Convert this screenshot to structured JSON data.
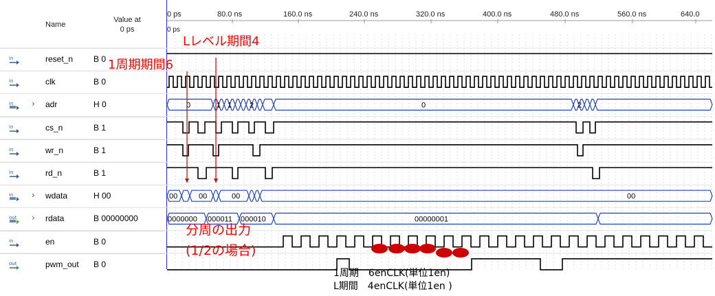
{
  "header": {
    "name_col": "Name",
    "value_col_line1": "Value at",
    "value_col_line2": "0 ps",
    "cursor_label": "0 ps",
    "time_ticks": [
      "0 ps",
      "80.0 ns",
      "160.0 ns",
      "240.0 ns",
      "320.0 ns",
      "400.0 ns",
      "480.0 ns",
      "560.0 ns",
      "640.0"
    ]
  },
  "signals": [
    {
      "name": "reset_n",
      "value": "B 0",
      "dir": "in",
      "bus": false
    },
    {
      "name": "clk",
      "value": "B 0",
      "dir": "in",
      "bus": false
    },
    {
      "name": "adr",
      "value": "H 0",
      "dir": "in",
      "bus": true
    },
    {
      "name": "cs_n",
      "value": "B 1",
      "dir": "in",
      "bus": false
    },
    {
      "name": "wr_n",
      "value": "B 1",
      "dir": "in",
      "bus": false
    },
    {
      "name": "rd_n",
      "value": "B 1",
      "dir": "in",
      "bus": false
    },
    {
      "name": "wdata",
      "value": "H 00",
      "dir": "in",
      "bus": true
    },
    {
      "name": "rdata",
      "value": "B 00000000",
      "dir": "out",
      "bus": true
    },
    {
      "name": "en",
      "value": "B 0",
      "dir": "in",
      "bus": false
    },
    {
      "name": "pwm_out",
      "value": "B 0",
      "dir": "out",
      "bus": false
    }
  ],
  "bus_labels": {
    "adr": [
      "0",
      "1",
      "1",
      "2",
      "0",
      "2"
    ],
    "wdata": [
      "00",
      "00",
      "00",
      "00"
    ],
    "rdata": [
      "0000000",
      "000011",
      "000010",
      "00000001"
    ]
  },
  "icons": {
    "in": "input-pin-icon",
    "in_bus": "input-bus-icon",
    "out": "output-pin-icon",
    "out_bus": "output-bus-icon",
    "expand": "chevron-right-icon"
  },
  "annotations": {
    "low_period": "Lレベル期間4",
    "period": "1周期期間6",
    "divider_line1": "分周の出力",
    "divider_line2": "(1/2の場合)"
  },
  "notes": {
    "line1": "1周期　6enCLK(単位1en)",
    "line2": "L期間　4enCLK(単位1en )"
  },
  "colors": {
    "annotation": "#ff0000",
    "waveform": "#000000",
    "bus": "#2244cc",
    "marker": "#cc0000",
    "divider": "#2a2ad0"
  }
}
